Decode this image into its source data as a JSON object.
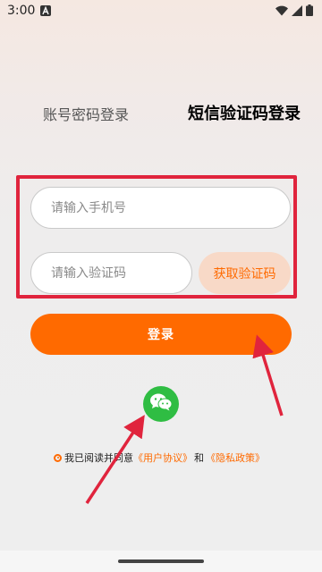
{
  "status_bar": {
    "time": "3:00",
    "notification_icon": "a-letter-icon",
    "icons": [
      "wifi-icon",
      "signal-icon",
      "battery-icon"
    ]
  },
  "tabs": [
    {
      "label": "账号密码登录",
      "active": false
    },
    {
      "label": "短信验证码登录",
      "active": true
    }
  ],
  "form": {
    "phone_placeholder": "请输入手机号",
    "code_placeholder": "请输入验证码",
    "get_code_label": "获取验证码",
    "login_label": "登录"
  },
  "social_login": {
    "icon": "wechat-icon"
  },
  "agreement": {
    "prefix": "我已阅读并同意",
    "user_agreement": "《用户协议》",
    "connector": "和",
    "privacy_policy": "《隐私政策》"
  },
  "colors": {
    "accent": "#ff6a00",
    "annotation_red": "#e0243d",
    "wechat_green": "#2fbd43"
  }
}
